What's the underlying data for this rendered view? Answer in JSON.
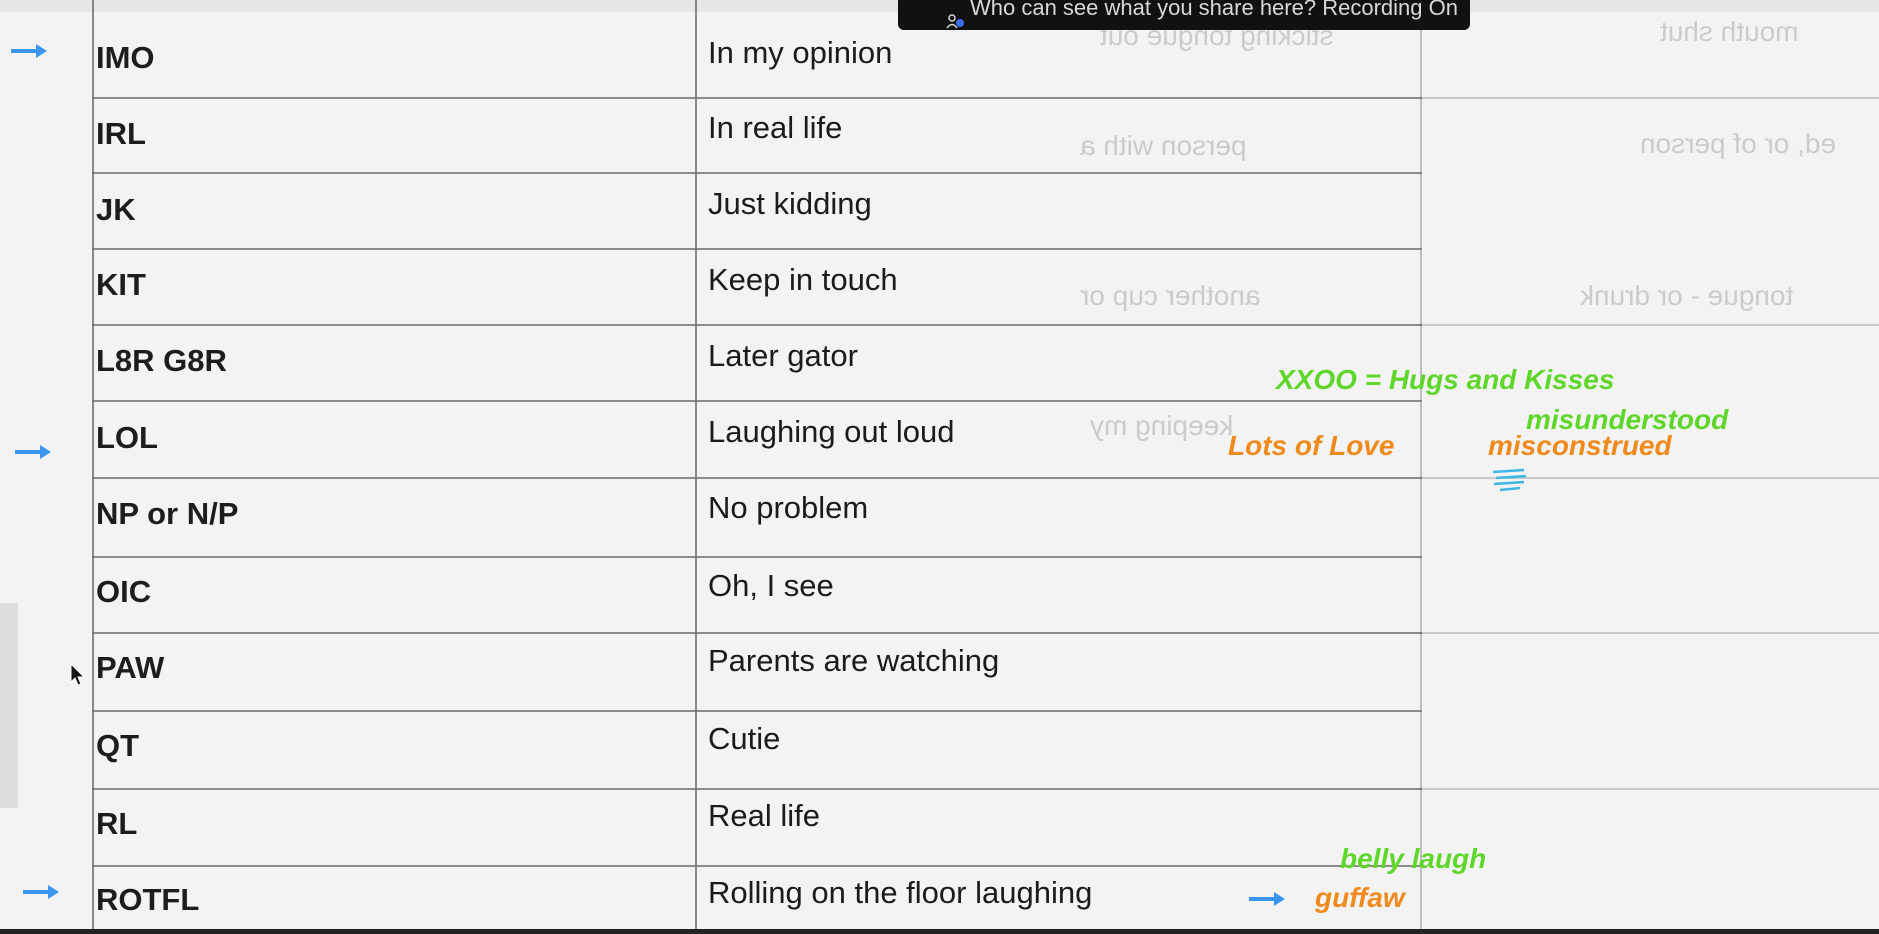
{
  "recording_banner": {
    "text": "Who can see what you share here? Recording On",
    "icon": "people-icon"
  },
  "rows": [
    {
      "abbr": "IMO",
      "meaning": "In my opinion"
    },
    {
      "abbr": "IRL",
      "meaning": "In real life"
    },
    {
      "abbr": "JK",
      "meaning": "Just kidding"
    },
    {
      "abbr": "KIT",
      "meaning": "Keep in touch"
    },
    {
      "abbr": "L8R G8R",
      "meaning": "Later gator"
    },
    {
      "abbr": "LOL",
      "meaning": "Laughing out loud"
    },
    {
      "abbr": "NP or N/P",
      "meaning": "No problem"
    },
    {
      "abbr": "OIC",
      "meaning": "Oh, I see"
    },
    {
      "abbr": "PAW",
      "meaning": "Parents are watching"
    },
    {
      "abbr": "QT",
      "meaning": "Cutie"
    },
    {
      "abbr": "RL",
      "meaning": "Real life"
    },
    {
      "abbr": "ROTFL",
      "meaning": "Rolling on the floor laughing"
    }
  ],
  "annotations": {
    "xxoo": "XXOO = Hugs and Kisses",
    "misunderstood": "misunderstood",
    "lots_of_love": "Lots of Love",
    "misconstrued": "misconstrued",
    "belly_laugh": "belly laugh",
    "guffaw": "guffaw"
  },
  "colors": {
    "arrow": "#3b95ee",
    "green": "#5ed62a",
    "orange": "#f08a1c",
    "scribble": "#3fb6e8"
  }
}
